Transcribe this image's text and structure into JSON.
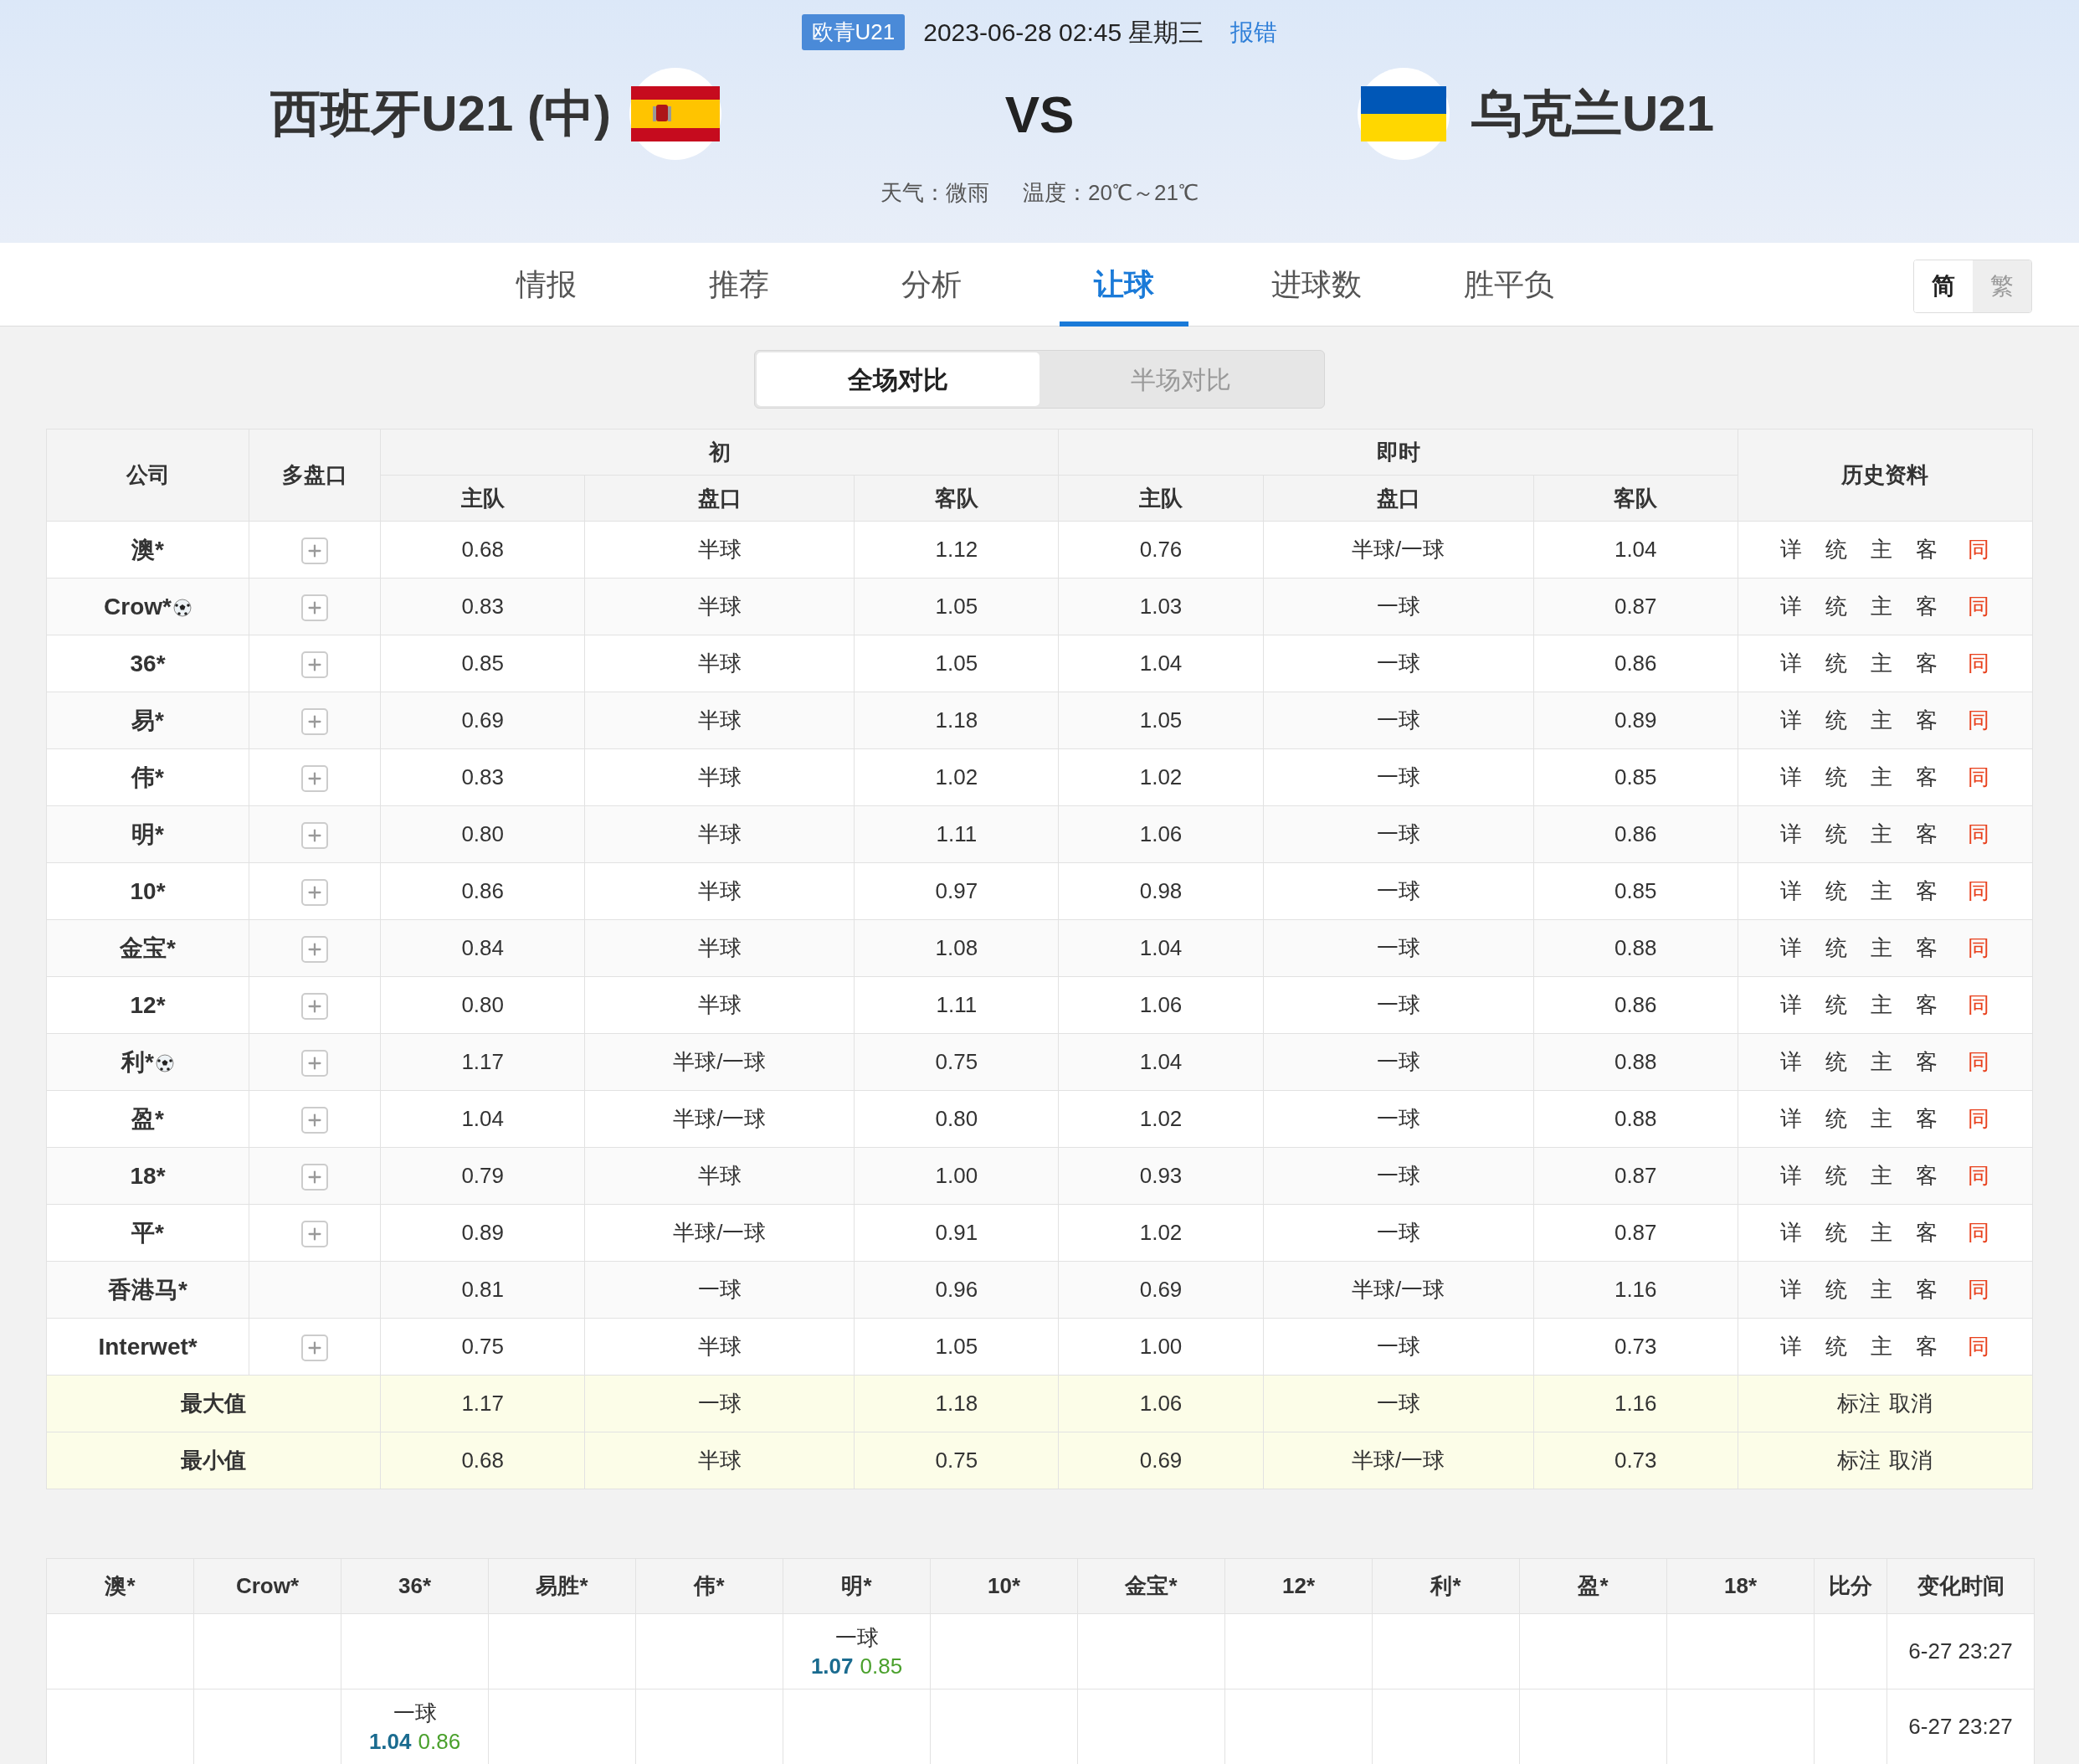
{
  "match": {
    "league": "欧青U21",
    "datetime": "2023-06-28 02:45 星期三",
    "report_link": "报错",
    "home_team": "西班牙U21 (中)",
    "versus": "VS",
    "away_team": "乌克兰U21",
    "weather": "天气：微雨",
    "temperature": "温度：20℃～21℃"
  },
  "tabs": [
    {
      "label": "情报",
      "selected": false
    },
    {
      "label": "推荐",
      "selected": false
    },
    {
      "label": "分析",
      "selected": false
    },
    {
      "label": "让球",
      "selected": true
    },
    {
      "label": "进球数",
      "selected": false
    },
    {
      "label": "胜平负",
      "selected": false
    }
  ],
  "script_toggle": [
    {
      "label": "简",
      "selected": true
    },
    {
      "label": "繁",
      "selected": false
    }
  ],
  "compare_toggle": [
    {
      "label": "全场对比",
      "selected": true
    },
    {
      "label": "半场对比",
      "selected": false
    }
  ],
  "odds_table": {
    "header": {
      "company": "公司",
      "multi": "多盘口",
      "initial": "初",
      "live": "即时",
      "history": "历史资料",
      "sub_columns": [
        "主队",
        "盘口",
        "客队",
        "主队",
        "盘口",
        "客队"
      ]
    },
    "rows": [
      {
        "kind": "company",
        "company": "澳*",
        "ball": false,
        "multi": true,
        "values": [
          "0.68",
          "半球",
          "1.12",
          "0.76",
          "半球/一球",
          "1.04"
        ],
        "links": [
          "详",
          "统",
          "主",
          "客",
          "同"
        ]
      },
      {
        "kind": "company",
        "company": "Crow*",
        "ball": true,
        "multi": true,
        "values": [
          "0.83",
          "半球",
          "1.05",
          "1.03",
          "一球",
          "0.87"
        ],
        "links": [
          "详",
          "统",
          "主",
          "客",
          "同"
        ]
      },
      {
        "kind": "company",
        "company": "36*",
        "ball": false,
        "multi": true,
        "values": [
          "0.85",
          "半球",
          "1.05",
          "1.04",
          "一球",
          "0.86"
        ],
        "links": [
          "详",
          "统",
          "主",
          "客",
          "同"
        ]
      },
      {
        "kind": "company",
        "company": "易*",
        "ball": false,
        "multi": true,
        "values": [
          "0.69",
          "半球",
          "1.18",
          "1.05",
          "一球",
          "0.89"
        ],
        "links": [
          "详",
          "统",
          "主",
          "客",
          "同"
        ]
      },
      {
        "kind": "company",
        "company": "伟*",
        "ball": false,
        "multi": true,
        "values": [
          "0.83",
          "半球",
          "1.02",
          "1.02",
          "一球",
          "0.85"
        ],
        "links": [
          "详",
          "统",
          "主",
          "客",
          "同"
        ]
      },
      {
        "kind": "company",
        "company": "明*",
        "ball": false,
        "multi": true,
        "values": [
          "0.80",
          "半球",
          "1.11",
          "1.06",
          "一球",
          "0.86"
        ],
        "links": [
          "详",
          "统",
          "主",
          "客",
          "同"
        ]
      },
      {
        "kind": "company",
        "company": "10*",
        "ball": false,
        "multi": true,
        "values": [
          "0.86",
          "半球",
          "0.97",
          "0.98",
          "一球",
          "0.85"
        ],
        "links": [
          "详",
          "统",
          "主",
          "客",
          "同"
        ]
      },
      {
        "kind": "company",
        "company": "金宝*",
        "ball": false,
        "multi": true,
        "values": [
          "0.84",
          "半球",
          "1.08",
          "1.04",
          "一球",
          "0.88"
        ],
        "links": [
          "详",
          "统",
          "主",
          "客",
          "同"
        ]
      },
      {
        "kind": "company",
        "company": "12*",
        "ball": false,
        "multi": true,
        "values": [
          "0.80",
          "半球",
          "1.11",
          "1.06",
          "一球",
          "0.86"
        ],
        "links": [
          "详",
          "统",
          "主",
          "客",
          "同"
        ]
      },
      {
        "kind": "company",
        "company": "利*",
        "ball": true,
        "multi": true,
        "values": [
          "1.17",
          "半球/一球",
          "0.75",
          "1.04",
          "一球",
          "0.88"
        ],
        "links": [
          "详",
          "统",
          "主",
          "客",
          "同"
        ]
      },
      {
        "kind": "company",
        "company": "盈*",
        "ball": false,
        "multi": true,
        "values": [
          "1.04",
          "半球/一球",
          "0.80",
          "1.02",
          "一球",
          "0.88"
        ],
        "links": [
          "详",
          "统",
          "主",
          "客",
          "同"
        ]
      },
      {
        "kind": "company",
        "company": "18*",
        "ball": false,
        "multi": true,
        "values": [
          "0.79",
          "半球",
          "1.00",
          "0.93",
          "一球",
          "0.87"
        ],
        "links": [
          "详",
          "统",
          "主",
          "客",
          "同"
        ]
      },
      {
        "kind": "company",
        "company": "平*",
        "ball": false,
        "multi": true,
        "values": [
          "0.89",
          "半球/一球",
          "0.91",
          "1.02",
          "一球",
          "0.87"
        ],
        "links": [
          "详",
          "统",
          "主",
          "客",
          "同"
        ]
      },
      {
        "kind": "company",
        "company": "香港马*",
        "ball": false,
        "multi": false,
        "values": [
          "0.81",
          "一球",
          "0.96",
          "0.69",
          "半球/一球",
          "1.16"
        ],
        "links": [
          "详",
          "统",
          "主",
          "客",
          "同"
        ]
      },
      {
        "kind": "company",
        "company": "Interwet*",
        "ball": false,
        "multi": true,
        "values": [
          "0.75",
          "半球",
          "1.05",
          "1.00",
          "一球",
          "0.73"
        ],
        "links": [
          "详",
          "统",
          "主",
          "客",
          "同"
        ]
      },
      {
        "kind": "summary",
        "company": "最大值",
        "values": [
          "1.17",
          "一球",
          "1.18",
          "1.06",
          "一球",
          "1.16"
        ],
        "links": [
          "标注",
          "取消"
        ]
      },
      {
        "kind": "summary",
        "company": "最小值",
        "values": [
          "0.68",
          "半球",
          "0.75",
          "0.69",
          "半球/一球",
          "0.73"
        ],
        "links": [
          "标注",
          "取消"
        ]
      }
    ]
  },
  "changes_table": {
    "columns": [
      "澳*",
      "Crow*",
      "36*",
      "易胜*",
      "伟*",
      "明*",
      "10*",
      "金宝*",
      "12*",
      "利*",
      "盈*",
      "18*",
      "比分",
      "变化时间"
    ],
    "rows": [
      {
        "cells": [
          null,
          null,
          null,
          null,
          null,
          {
            "handicap": "一球",
            "home": "1.07",
            "away": "0.85"
          },
          null,
          null,
          null,
          null,
          null,
          null
        ],
        "time": "6-27 23:27"
      },
      {
        "cells": [
          null,
          null,
          {
            "handicap": "一球",
            "home": "1.04",
            "away": "0.86"
          },
          null,
          null,
          null,
          null,
          null,
          null,
          null,
          null,
          null
        ],
        "time": "6-27 23:27"
      }
    ]
  }
}
